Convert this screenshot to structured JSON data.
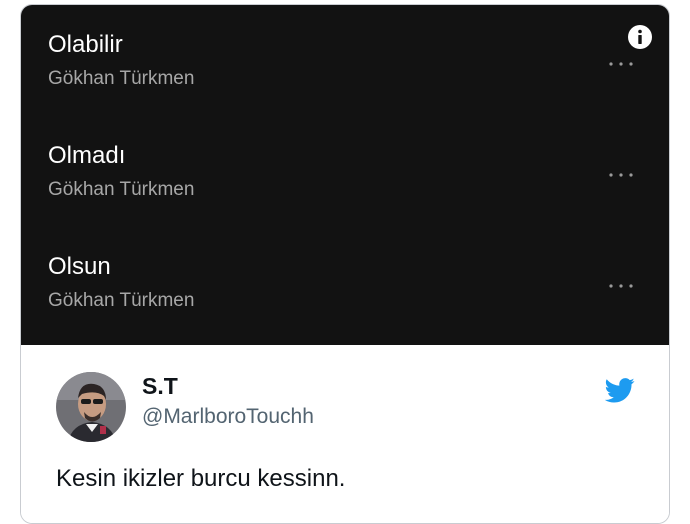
{
  "player": {
    "tracks": [
      {
        "title": "Olabilir",
        "artist": "Gökhan Türkmen"
      },
      {
        "title": "Olmadı",
        "artist": "Gökhan Türkmen"
      },
      {
        "title": "Olsun",
        "artist": "Gökhan Türkmen"
      }
    ],
    "icons": {
      "info": "info-icon",
      "more": "more-options-icon"
    },
    "colors": {
      "background": "#121212",
      "title": "#ffffff",
      "artist": "#a7a7a7"
    }
  },
  "tweet": {
    "display_name": "S.T",
    "handle": "@MarlboroTouchh",
    "text": "Kesin ikizler burcu kessinn.",
    "icons": {
      "brand": "twitter-bird-icon",
      "avatar": "avatar"
    },
    "colors": {
      "brand": "#1d9bf0",
      "name": "#0f1419",
      "handle": "#536471"
    }
  }
}
